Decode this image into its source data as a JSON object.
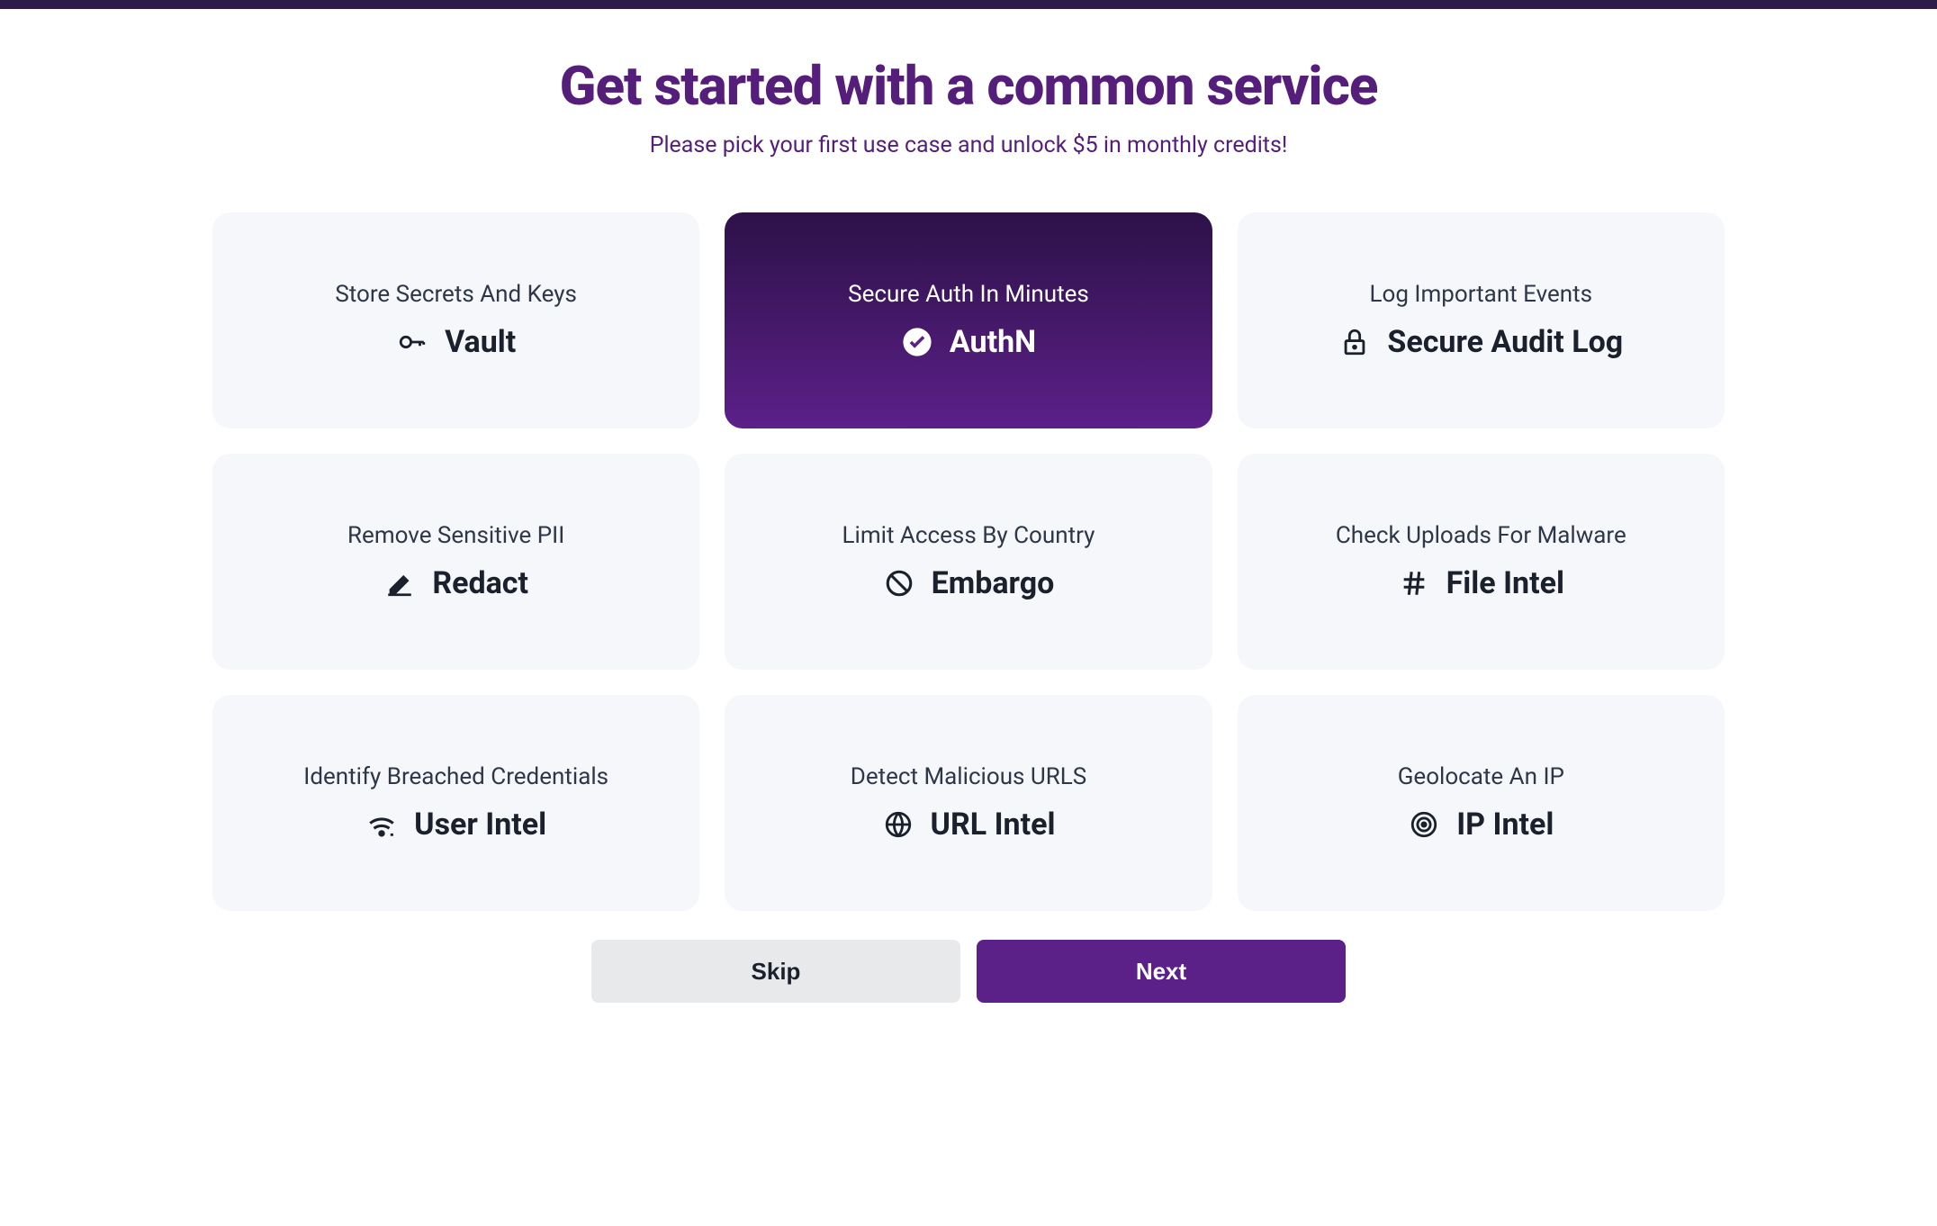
{
  "header": {
    "title": "Get started with a common service",
    "subtitle": "Please pick your first use case and unlock $5 in monthly credits!"
  },
  "services": [
    {
      "subtitle": "Store Secrets And Keys",
      "title": "Vault",
      "icon": "key-icon",
      "selected": false
    },
    {
      "subtitle": "Secure Auth In Minutes",
      "title": "AuthN",
      "icon": "check-circle-icon",
      "selected": true
    },
    {
      "subtitle": "Log Important Events",
      "title": "Secure Audit Log",
      "icon": "lock-icon",
      "selected": false
    },
    {
      "subtitle": "Remove Sensitive PII",
      "title": "Redact",
      "icon": "edit-icon",
      "selected": false
    },
    {
      "subtitle": "Limit Access By Country",
      "title": "Embargo",
      "icon": "block-icon",
      "selected": false
    },
    {
      "subtitle": "Check Uploads For Malware",
      "title": "File Intel",
      "icon": "hash-icon",
      "selected": false
    },
    {
      "subtitle": "Identify Breached Credentials",
      "title": "User Intel",
      "icon": "signal-icon",
      "selected": false
    },
    {
      "subtitle": "Detect Malicious URLS",
      "title": "URL Intel",
      "icon": "globe-icon",
      "selected": false
    },
    {
      "subtitle": "Geolocate An IP",
      "title": "IP Intel",
      "icon": "target-icon",
      "selected": false
    }
  ],
  "buttons": {
    "skip": "Skip",
    "next": "Next"
  }
}
